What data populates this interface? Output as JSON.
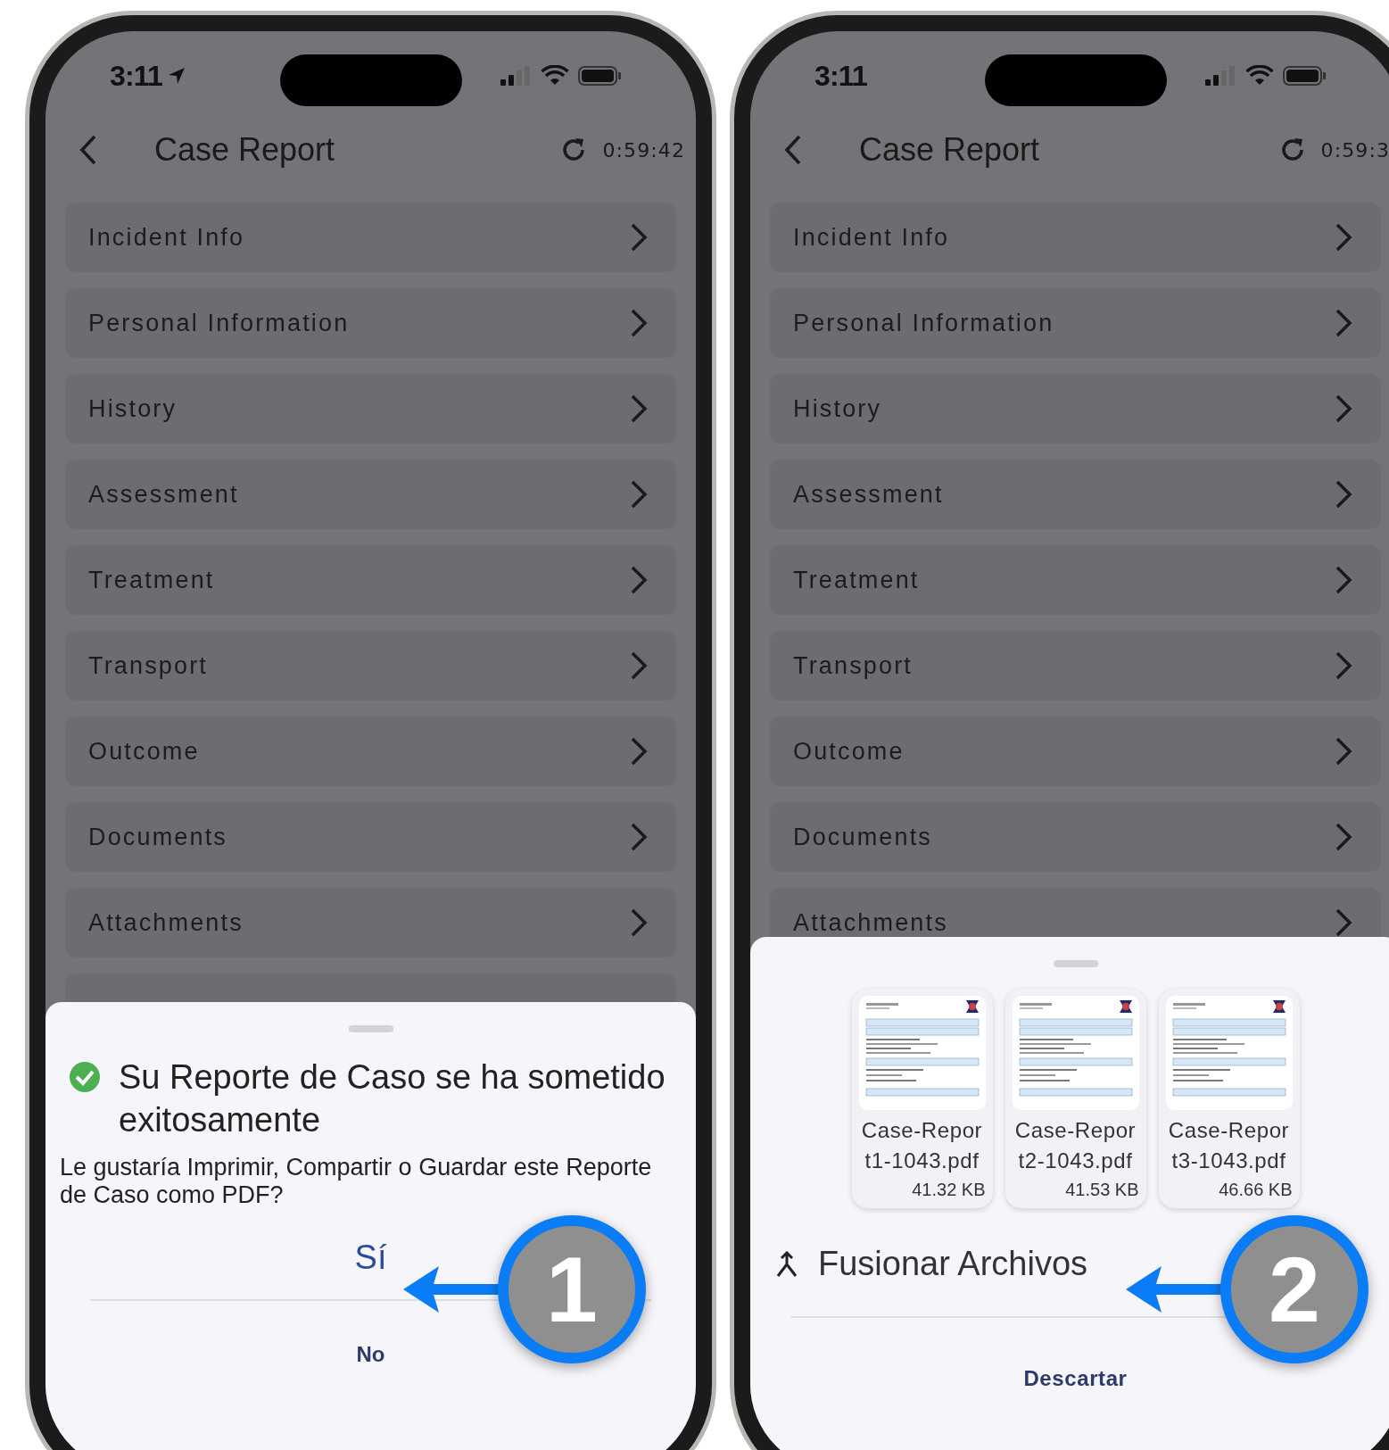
{
  "phones": [
    {
      "status": {
        "time": "3:11",
        "location": true
      },
      "header": {
        "title": "Case Report",
        "timer": "0:59:42"
      },
      "menu": [
        "Incident Info",
        "Personal Information",
        "History",
        "Assessment",
        "Treatment",
        "Transport",
        "Outcome",
        "Documents",
        "Attachments"
      ],
      "sheet": {
        "kind": "confirm",
        "title": "Su Reporte de Caso se ha sometido exitosamente",
        "message": "Le gustaría Imprimir, Compartir o Guardar este Reporte de Caso como PDF?",
        "confirm": "Sí",
        "cancel": "No"
      },
      "callout": "1"
    },
    {
      "status": {
        "time": "3:11",
        "location": false
      },
      "header": {
        "title": "Case Report",
        "timer": "0:59:3"
      },
      "menu": [
        "Incident Info",
        "Personal Information",
        "History",
        "Assessment",
        "Treatment",
        "Transport",
        "Outcome",
        "Documents",
        "Attachments"
      ],
      "sheet": {
        "kind": "files",
        "files": [
          {
            "name": "Case-Report1-1043.pdf",
            "size": "41.32 KB"
          },
          {
            "name": "Case-Report2-1043.pdf",
            "size": "41.53 KB"
          },
          {
            "name": "Case-Report3-1043.pdf",
            "size": "46.66 KB"
          }
        ],
        "action": "Fusionar Archivos",
        "cancel": "Descartar"
      },
      "callout": "2"
    }
  ]
}
